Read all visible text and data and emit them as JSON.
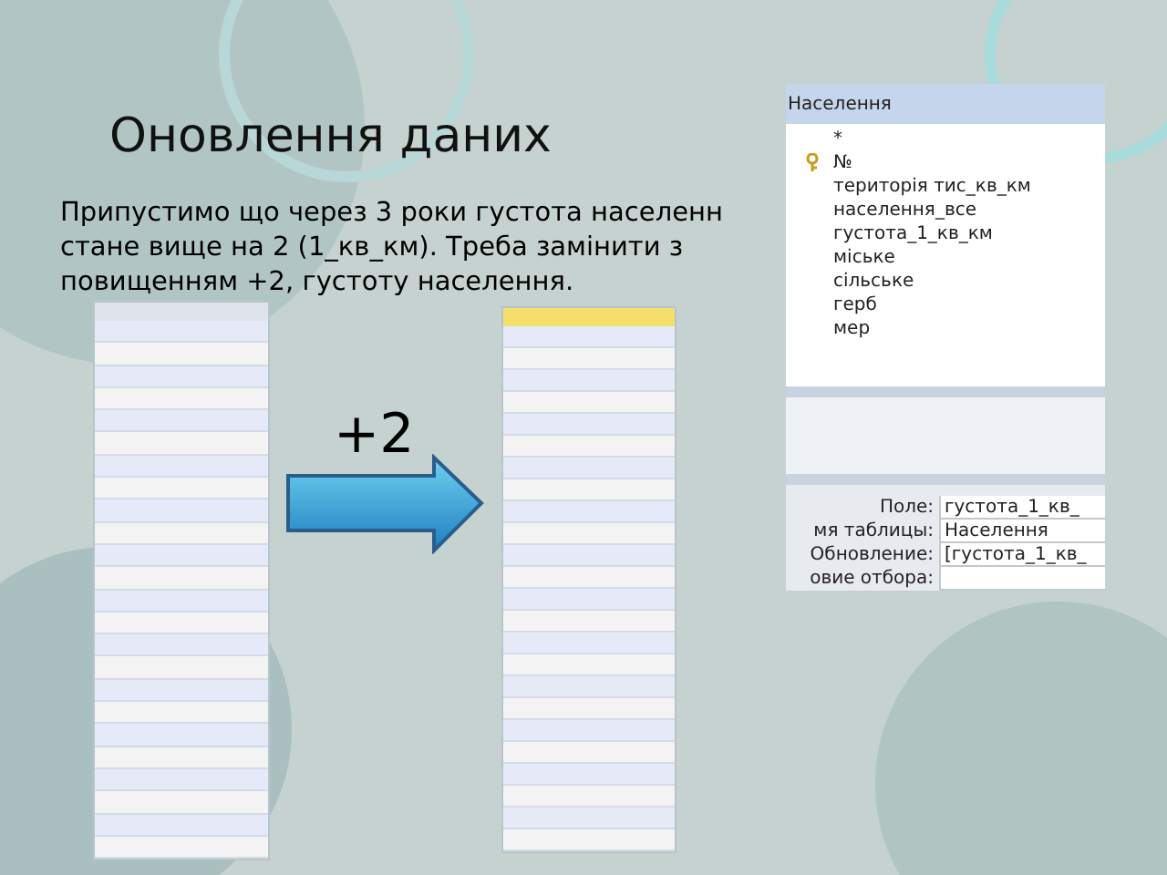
{
  "slide": {
    "title": "Оновлення даних",
    "text_lines": [
      "Припустимо що через 3 роки густота населенн",
      "стане вище на 2 (1_кв_км). Треба замінити з",
      "повищенням +2, густоту населення."
    ],
    "arrow_label": "+2"
  },
  "query_window": {
    "table_title": "Населення",
    "fields": [
      {
        "name": "*",
        "key": false
      },
      {
        "name": "№",
        "key": true
      },
      {
        "name": "територія тис_кв_км",
        "key": false
      },
      {
        "name": "населення_все",
        "key": false
      },
      {
        "name": "густота_1_кв_км",
        "key": false
      },
      {
        "name": "міське",
        "key": false
      },
      {
        "name": "сільське",
        "key": false
      },
      {
        "name": "герб",
        "key": false
      },
      {
        "name": "мер",
        "key": false
      }
    ],
    "grid": [
      {
        "label": "Поле:",
        "value": "густота_1_кв_"
      },
      {
        "label": "мя таблицы:",
        "value": "Населення"
      },
      {
        "label": "Обновление:",
        "value": "[густота_1_кв_"
      },
      {
        "label": "овие отбора:"
      }
    ]
  }
}
